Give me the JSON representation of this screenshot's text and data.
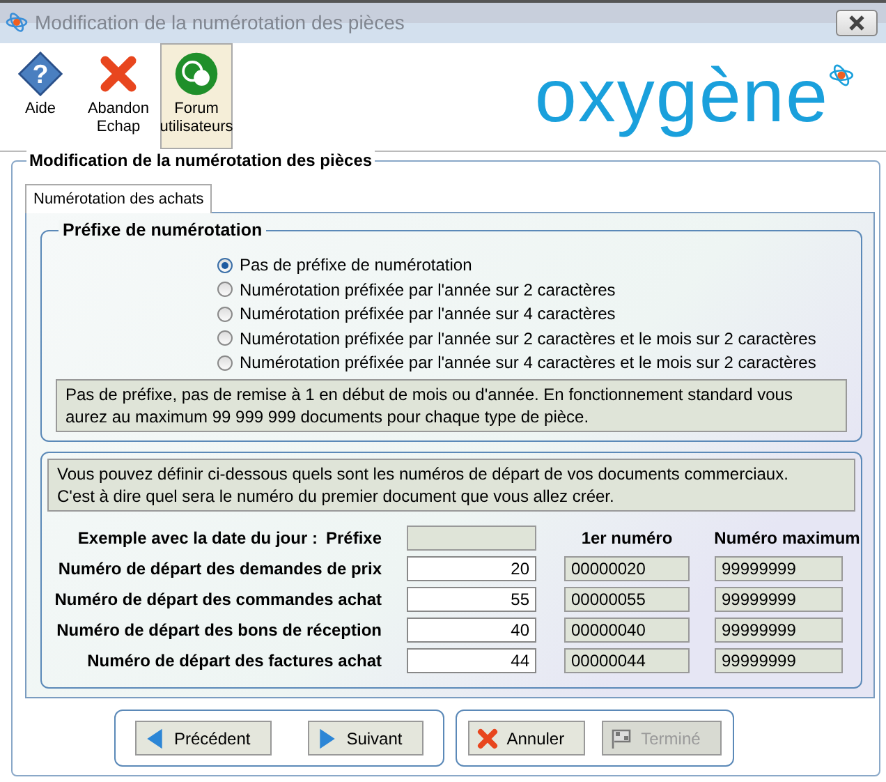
{
  "window": {
    "title": "Modification de la numérotation des pièces"
  },
  "toolbar": [
    {
      "kind": "help",
      "glyph": "?",
      "lines": [
        "Aide"
      ],
      "selected": false
    },
    {
      "kind": "cancel",
      "lines": [
        "Abandon",
        "Echap"
      ],
      "selected": false
    },
    {
      "kind": "forum",
      "lines": [
        "Forum",
        "utilisateurs"
      ],
      "selected": true
    }
  ],
  "logo": "oxygène",
  "group_title": "Modification de la numérotation des pièces",
  "tabs": [
    {
      "label": "Numérotation des achats",
      "selected": true
    }
  ],
  "prefix": {
    "title": "Préfixe de numérotation",
    "options": [
      {
        "label": "Pas de préfixe de numérotation",
        "selected": true
      },
      {
        "label": "Numérotation préfixée par l'année sur 2 caractères",
        "selected": false
      },
      {
        "label": "Numérotation préfixée par l'année sur 4 caractères",
        "selected": false
      },
      {
        "label": "Numérotation préfixée par l'année sur 2 caractères et le mois sur 2 caractères",
        "selected": false
      },
      {
        "label": "Numérotation préfixée par l'année sur 4 caractères et le mois sur 2 caractères",
        "selected": false
      }
    ],
    "description": "Pas de préfixe, pas de remise à 1 en début de mois ou d'année. En fonctionnement standard vous aurez au maximum 99 999 999 documents pour chaque type de pièce."
  },
  "numbering": {
    "intro": [
      "Vous pouvez définir ci-dessous quels sont les numéros de départ de vos documents commerciaux.",
      "C'est à dire quel sera le numéro du premier document que vous allez créer."
    ],
    "example_label": "Exemple avec la date du jour :",
    "prefix_label": "Préfixe",
    "first_header": "1er numéro",
    "max_header": "Numéro maximum",
    "rows": [
      {
        "label": "Numéro de départ des demandes de prix",
        "value": "20",
        "first": "00000020",
        "max": "99999999"
      },
      {
        "label": "Numéro de départ des commandes achat",
        "value": "55",
        "first": "00000055",
        "max": "99999999"
      },
      {
        "label": "Numéro de départ des bons de réception",
        "value": "40",
        "first": "00000040",
        "max": "99999999"
      },
      {
        "label": "Numéro de départ des factures achat",
        "value": "44",
        "first": "00000044",
        "max": "99999999"
      }
    ]
  },
  "nav_buttons": [
    {
      "kind": "prev",
      "label": "Précédent",
      "disabled": false
    },
    {
      "kind": "next",
      "label": "Suivant",
      "disabled": false
    }
  ],
  "action_buttons": [
    {
      "kind": "cancel",
      "label": "Annuler",
      "disabled": false
    },
    {
      "kind": "finish",
      "label": "Terminé",
      "disabled": true
    }
  ]
}
